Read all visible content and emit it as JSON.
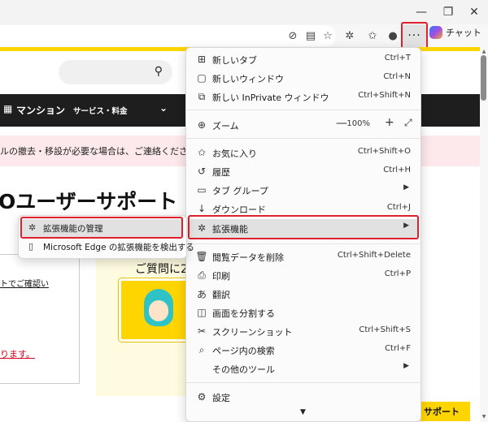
{
  "toolbar": {
    "more_label": "···",
    "copilot_label": "チャット"
  },
  "page": {
    "nav_brand": "マンション",
    "nav_item": "サービス・料金",
    "notice_text": "ルの撤去・移設が必要な場合は、ご連絡ください。",
    "heading": "Oユーザーサポート",
    "link1": "トでご確認い",
    "link2": "ります。",
    "promo_text": "ご質問に2",
    "support_label": "サポート"
  },
  "menu": {
    "items": [
      {
        "icon": "new-tab-icon",
        "label": "新しいタブ",
        "shortcut": "Ctrl+T"
      },
      {
        "icon": "new-window-icon",
        "label": "新しいウィンドウ",
        "shortcut": "Ctrl+N"
      },
      {
        "icon": "inprivate-icon",
        "label": "新しい InPrivate ウィンドウ",
        "shortcut": "Ctrl+Shift+N"
      },
      {
        "icon": "zoom-icon",
        "label": "ズーム",
        "zoom_value": "100%"
      },
      {
        "icon": "favorites-icon",
        "label": "お気に入り",
        "shortcut": "Ctrl+Shift+O"
      },
      {
        "icon": "history-icon",
        "label": "履歴",
        "shortcut": "Ctrl+H"
      },
      {
        "icon": "tab-groups-icon",
        "label": "タブ グループ"
      },
      {
        "icon": "download-icon",
        "label": "ダウンロード",
        "shortcut": "Ctrl+J"
      },
      {
        "icon": "extensions-icon",
        "label": "拡張機能"
      },
      {
        "icon": "delete-browsing-data-icon",
        "label": "閲覧データを削除",
        "shortcut": "Ctrl+Shift+Delete"
      },
      {
        "icon": "print-icon",
        "label": "印刷",
        "shortcut": "Ctrl+P"
      },
      {
        "icon": "translate-icon",
        "label": "翻訳"
      },
      {
        "icon": "split-screen-icon",
        "label": "画面を分割する"
      },
      {
        "icon": "screenshot-icon",
        "label": "スクリーンショット",
        "shortcut": "Ctrl+Shift+S"
      },
      {
        "icon": "find-on-page-icon",
        "label": "ページ内の検索",
        "shortcut": "Ctrl+F"
      },
      {
        "icon": "",
        "label": "その他のツール"
      },
      {
        "icon": "settings-icon",
        "label": "設定"
      }
    ]
  },
  "submenu": {
    "items": [
      {
        "icon": "extensions-icon",
        "label": "拡張機能の管理"
      },
      {
        "icon": "store-icon",
        "label": "Microsoft Edge の拡張機能を検出する"
      }
    ]
  },
  "colors": {
    "highlight_box": "#e0202d",
    "brand_yellow": "#ffd500"
  }
}
